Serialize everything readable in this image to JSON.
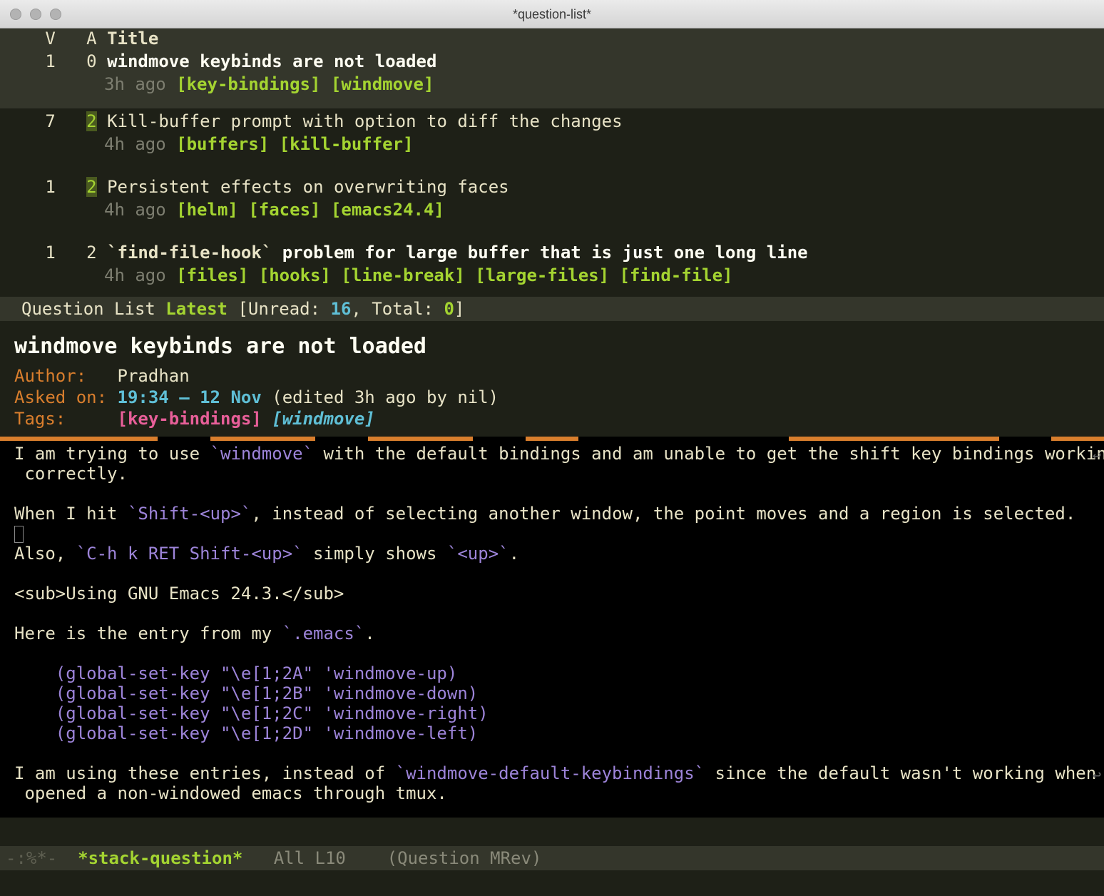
{
  "window_title": "*question-list*",
  "header": {
    "v": "V",
    "a": "A",
    "title": "Title"
  },
  "questions": [
    {
      "votes": "1",
      "answers": "0",
      "ans_hl": false,
      "title": "windmove keybinds are not loaded",
      "bold": true,
      "selected": true,
      "time": "3h ago",
      "tags": [
        "key-bindings",
        "windmove"
      ]
    },
    {
      "votes": "7",
      "answers": "2",
      "ans_hl": true,
      "title": "Kill-buffer prompt with option to diff the changes",
      "bold": false,
      "selected": false,
      "time": "4h ago",
      "tags": [
        "buffers",
        "kill-buffer"
      ]
    },
    {
      "votes": "1",
      "answers": "2",
      "ans_hl": true,
      "title": "Persistent effects on overwriting faces",
      "bold": false,
      "selected": false,
      "time": "4h ago",
      "tags": [
        "helm",
        "faces",
        "emacs24.4"
      ]
    },
    {
      "votes": "1",
      "answers": "2",
      "ans_hl": false,
      "title_pre": "`find-file-hook`",
      "title_post": " problem for large buffer that is just one long line",
      "bold": true,
      "selected": false,
      "time": "4h ago",
      "tags": [
        "files",
        "hooks",
        "line-break",
        "large-files",
        "find-file"
      ]
    }
  ],
  "status1": {
    "label": "Question List",
    "mode": "Latest",
    "unread_label": "[Unread: ",
    "unread": "16",
    "sep": ", Total: ",
    "total": "0",
    "close": "]"
  },
  "detail": {
    "title": "windmove keybinds are not loaded",
    "author_key": "Author:",
    "author": "Pradhan",
    "asked_key": "Asked on:",
    "asked_time": "19:34 – 12 Nov",
    "asked_edit": "(edited 3h ago by nil)",
    "tags_key": "Tags:",
    "tag1": "[key-bindings]",
    "tag2": "[windmove]"
  },
  "body": {
    "l1a": "I am trying to use ",
    "l1b": "`windmove`",
    "l1c": " with the default bindings and am unable to get the shift key bindings working",
    "l2": " correctly.",
    "l4a": "When I hit ",
    "l4b": "`Shift-<up>`",
    "l4c": ", instead of selecting another window, the point moves and a region is selected.",
    "l6a": "Also, ",
    "l6b": "`C-h k RET Shift-<up>`",
    "l6c": " simply shows ",
    "l6d": "`<up>`",
    "l6e": ".",
    "l8": "<sub>Using GNU Emacs 24.3.</sub>",
    "l10a": "Here is the entry from my ",
    "l10b": "`.emacs`",
    "l10c": ".",
    "c1": "    (global-set-key \"\\e[1;2A\" 'windmove-up)",
    "c2": "    (global-set-key \"\\e[1;2B\" 'windmove-down)",
    "c3": "    (global-set-key \"\\e[1;2C\" 'windmove-right)",
    "c4": "    (global-set-key \"\\e[1;2D\" 'windmove-left)",
    "l16a": "I am using these entries, instead of ",
    "l16b": "`windmove-default-keybindings`",
    "l16c": " since the default wasn't working when I",
    "l17": " opened a non-windowed emacs through tmux."
  },
  "modeline": {
    "prefix": "-:%*-",
    "buffer": "*stack-question*",
    "pos": "All L10",
    "mode": "(Question MRev)"
  }
}
